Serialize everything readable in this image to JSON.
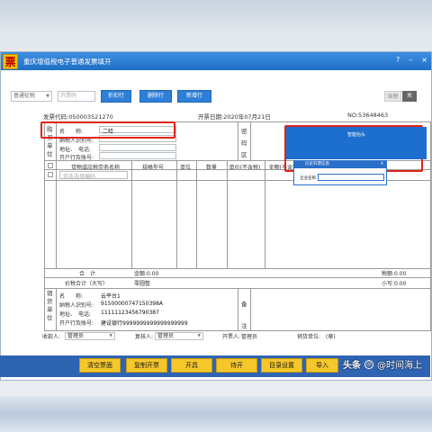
{
  "window": {
    "title": "重庆增值税电子普通发票填开",
    "app_icon": "票",
    "controls": [
      "?",
      "–",
      "×"
    ]
  },
  "toolbar": {
    "invoice_type": "普通征税",
    "invoice_code_placeholder": "开票码",
    "buttons": [
      "折扣行",
      "删除行",
      "新增行"
    ],
    "tax_incl_label": "含税",
    "close_label": "关"
  },
  "info": {
    "invoice_code": "发票代码:050003521270",
    "issue_date": "开票日期:2020年07月21日",
    "invoice_no": "NO:53648463"
  },
  "buyer": {
    "side_labels": [
      "购",
      "买",
      "单",
      "位"
    ],
    "name_label": "名　　称:",
    "name_value": "二哈",
    "taxid_label": "纳税人识别号:",
    "address_label": "地址、　电话:",
    "bank_label": "开户行及账号:",
    "code_area_labels": [
      "密",
      "码",
      "区"
    ]
  },
  "popup": {
    "title": "智能抬头",
    "subtitle": "历史开票信息",
    "close": "X",
    "search_label": "企业名称"
  },
  "items": {
    "columns": [
      "货物或应税劳务名称",
      "规格型号",
      "单位",
      "数量",
      "单价(不含税)",
      "金额(不含税)"
    ],
    "first_row_placeholder": "双击选择编码"
  },
  "totals": {
    "sum_label": "合　计",
    "amount": "金额:0.00",
    "tax": "税额:0.00",
    "total_label": "价税合计（大写）",
    "total_upper": "零圆整",
    "total_lower": "小写:0.00"
  },
  "seller": {
    "side_labels": [
      "销",
      "货",
      "单",
      "位"
    ],
    "name_label": "名　　称:",
    "name_value": "云平台1",
    "taxid_label": "纳税人识别号:",
    "taxid_value": "91500000747150398A",
    "address_label": "地址、　电话:",
    "address_value": "11111123456790387",
    "bank_label": "开户行及账号:",
    "bank_value": "建设银行9999999999999999999",
    "remark_labels": [
      "备",
      "注"
    ]
  },
  "footer": {
    "payee_label": "收款人:",
    "payee_value": "管理员",
    "reviewer_label": "复核人:",
    "reviewer_value": "管理员",
    "drawer_label": "开票人:",
    "drawer_value": "管理员",
    "seller_seal": "销货单位:　(章)"
  },
  "actions": [
    "清空票面",
    "复制开票",
    "开具",
    "待开",
    "目录设置",
    "导入"
  ],
  "watermark": {
    "brand": "头条",
    "author": "@时间海上"
  },
  "colors": {
    "titlebar": "#1f6fc6",
    "button_blue": "#2d7fd8",
    "action_yellow": "#f5c72a",
    "highlight_red": "#e2231a",
    "popup_blue": "#1c6fcf"
  }
}
